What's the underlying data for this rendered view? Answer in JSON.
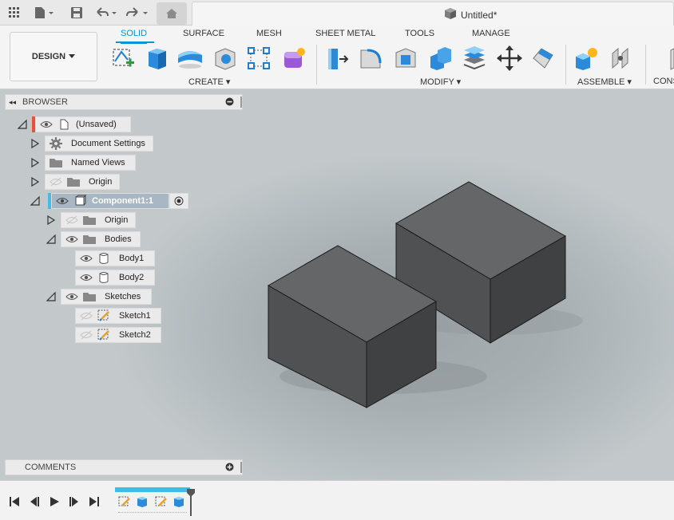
{
  "appbar": {
    "title": "Untitled*",
    "icons": [
      "grid-icon",
      "file-icon",
      "save-icon",
      "undo-icon",
      "redo-icon",
      "home-icon",
      "cube-icon"
    ]
  },
  "ribbon": {
    "workspace_label": "DESIGN",
    "tabs": [
      "SOLID",
      "SURFACE",
      "MESH",
      "SHEET METAL",
      "TOOLS",
      "MANAGE"
    ],
    "active_tab": "SOLID",
    "groups": {
      "create": "CREATE",
      "modify": "MODIFY",
      "assemble": "ASSEMBLE",
      "construct": "CONS"
    },
    "accent": "#0696d7"
  },
  "browser": {
    "title": "BROWSER",
    "items": [
      {
        "label": "(Unsaved)"
      },
      {
        "label": "Document Settings"
      },
      {
        "label": "Named Views"
      },
      {
        "label": "Origin"
      },
      {
        "label": "Component1:1"
      },
      {
        "label": "Origin"
      },
      {
        "label": "Bodies"
      },
      {
        "label": "Body1"
      },
      {
        "label": "Body2"
      },
      {
        "label": "Sketches"
      },
      {
        "label": "Sketch1"
      },
      {
        "label": "Sketch2"
      }
    ]
  },
  "comments": {
    "title": "COMMENTS"
  },
  "colors": {
    "body_top": "#646668",
    "body_front": "#4f5153",
    "body_side": "#3f4143",
    "component_marker": "#3fbde8",
    "unsaved_marker": "#e2533c"
  }
}
